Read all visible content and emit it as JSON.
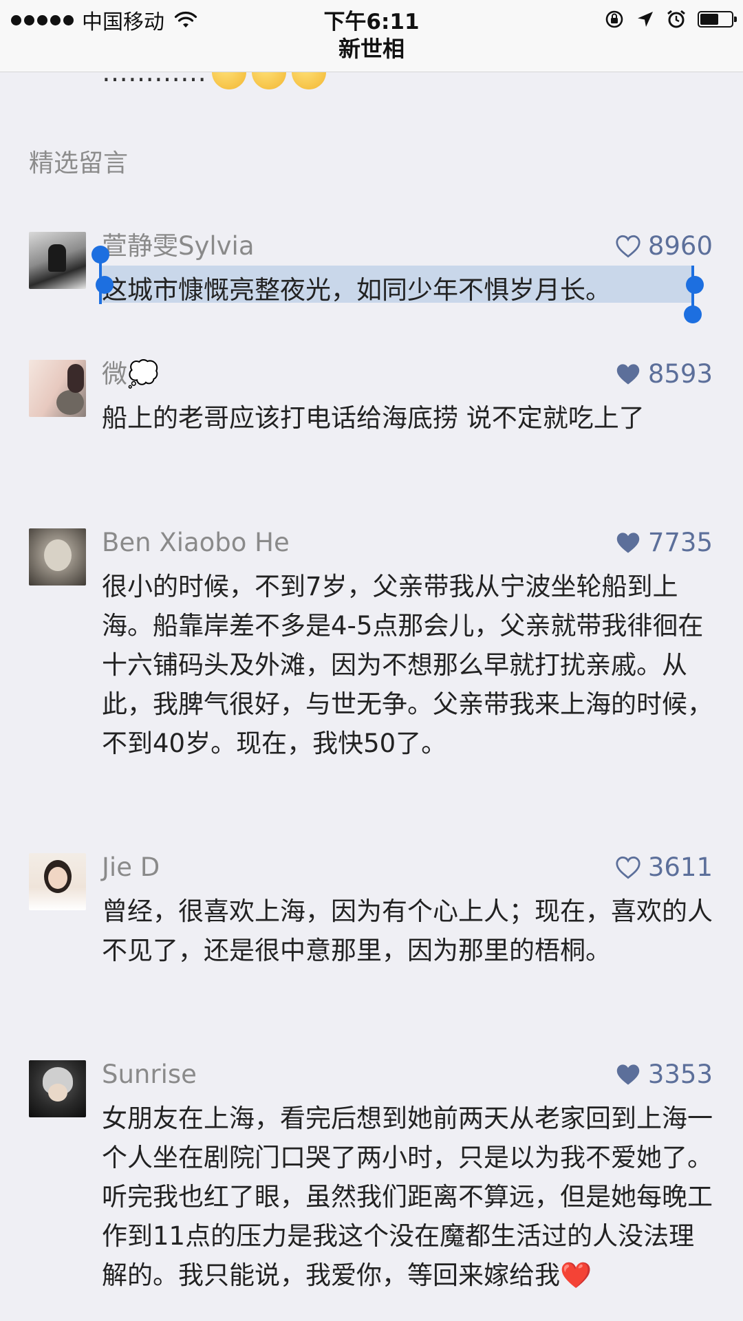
{
  "status_bar": {
    "carrier": "中国移动",
    "time": "下午6:11"
  },
  "nav": {
    "title": "新世相"
  },
  "partial_line": {
    "text": "…………"
  },
  "section": {
    "title": "精选留言"
  },
  "comments": [
    {
      "name": "萱静雯Sylvia",
      "likes": "8960",
      "liked": false,
      "text": "这城市慷慨亮整夜光，如同少年不惧岁月长。"
    },
    {
      "name": "微💭",
      "likes": "8593",
      "liked": true,
      "text": "船上的老哥应该打电话给海底捞 说不定就吃上了"
    },
    {
      "name": "Ben Xiaobo He",
      "likes": "7735",
      "liked": true,
      "text": "很小的时候，不到7岁，父亲带我从宁波坐轮船到上海。船靠岸差不多是4-5点那会儿，父亲就带我徘徊在十六铺码头及外滩，因为不想那么早就打扰亲戚。从此，我脾气很好，与世无争。父亲带我来上海的时候，不到40岁。现在，我快50了。"
    },
    {
      "name": "Jie D",
      "likes": "3611",
      "liked": false,
      "text": "曾经，很喜欢上海，因为有个心上人；现在，喜欢的人不见了，还是很中意那里，因为那里的梧桐。"
    },
    {
      "name": "Sunrise",
      "likes": "3353",
      "liked": true,
      "text": "女朋友在上海，看完后想到她前两天从老家回到上海一个人坐在剧院门口哭了两小时，只是以为我不爱她了。听完我也红了眼，虽然我们距离不算远，但是她每晚工作到11点的压力是我这个没在魔都生活过的人没法理解的。我只能说，我爱你，等回来嫁给我❤️"
    }
  ],
  "colors": {
    "like_blue": "#5c6f9a",
    "selection": "#c9d7ea",
    "handle": "#1d6fe0",
    "background": "#efeff4"
  },
  "battery_level": 0.6
}
